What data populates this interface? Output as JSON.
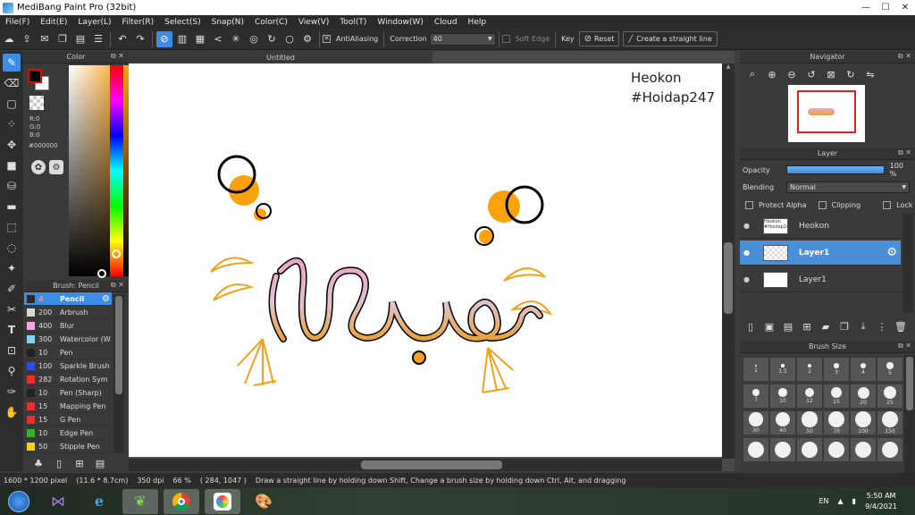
{
  "window": {
    "title": "MediBang Paint Pro (32bit)",
    "minimize": "—",
    "maximize": "☐",
    "close": "✕"
  },
  "menu": [
    "File(F)",
    "Edit(E)",
    "Layer(L)",
    "Filter(R)",
    "Select(S)",
    "Snap(N)",
    "Color(C)",
    "View(V)",
    "Tool(T)",
    "Window(W)",
    "Cloud",
    "Help"
  ],
  "toolbar": {
    "antialiasing_label": "AntiAliasing",
    "correction_label": "Correction",
    "correction_value": "40",
    "soft_edge_label": "Soft Edge",
    "key_label": "Key",
    "reset_label": "Reset",
    "straight_line_label": "Create a straight line"
  },
  "color_panel": {
    "title": "Color",
    "r": "R:0",
    "g": "G:0",
    "b": "B:0",
    "hex": "#000000",
    "fg_color": "#000000",
    "bg_color": "#ffffff"
  },
  "brush_panel": {
    "title": "Brush: Pencil",
    "items": [
      {
        "size": "4",
        "name": "Pencil",
        "color": "#2a2a2a"
      },
      {
        "size": "200",
        "name": "Arbrush",
        "color": "#d8d8d8"
      },
      {
        "size": "400",
        "name": "Blur",
        "color": "#f2a7e0"
      },
      {
        "size": "300",
        "name": "Watercolor (W",
        "color": "#7fd6f5"
      },
      {
        "size": "10",
        "name": "Pen",
        "color": "#222222"
      },
      {
        "size": "100",
        "name": "Sparkle Brush",
        "color": "#2d4cf0"
      },
      {
        "size": "282",
        "name": "Rotation Sym",
        "color": "#e83030"
      },
      {
        "size": "10",
        "name": "Pen (Sharp)",
        "color": "#222222"
      },
      {
        "size": "15",
        "name": "Mapping Pen",
        "color": "#e83030"
      },
      {
        "size": "15",
        "name": "G Pen",
        "color": "#e83030"
      },
      {
        "size": "10",
        "name": "Edge Pen",
        "color": "#33b030"
      },
      {
        "size": "50",
        "name": "Stipple Pen",
        "color": "#f0d020"
      }
    ]
  },
  "canvas": {
    "tab": "Untitled",
    "text_line1": "Heokon",
    "text_line2": "#Hoidap247"
  },
  "navigator": {
    "title": "Navigator"
  },
  "layer_panel": {
    "title": "Layer",
    "opacity_label": "Opacity",
    "opacity_value": "100 %",
    "opacity_fraction": 1.0,
    "blending_label": "Blending",
    "blending_value": "Normal",
    "protect_alpha": "Protect Alpha",
    "clipping": "Clipping",
    "lock": "Lock",
    "layers": [
      {
        "name": "Heokon",
        "thumb": "Heokon #Hoidap247"
      },
      {
        "name": "Layer1",
        "thumb": ""
      },
      {
        "name": "Layer1",
        "thumb": ""
      }
    ]
  },
  "brush_size": {
    "title": "Brush Size",
    "sizes": [
      "1",
      "1.5",
      "2",
      "3",
      "4",
      "5",
      "7",
      "10",
      "12",
      "15",
      "20",
      "25",
      "30",
      "40",
      "50",
      "70",
      "100",
      "150",
      "",
      "",
      "",
      "",
      "",
      ""
    ]
  },
  "status": {
    "dimensions": "1600 * 1200 pixel",
    "physical": "(11.6 * 8.7cm)",
    "dpi": "350 dpi",
    "zoom": "66 %",
    "coords": "( 284, 1047 )",
    "hint": "Draw a straight line by holding down Shift, Change a brush size by holding down Ctrl, Alt, and dragging"
  },
  "taskbar": {
    "lang": "EN",
    "time": "5:50 AM",
    "date": "9/4/2021"
  }
}
